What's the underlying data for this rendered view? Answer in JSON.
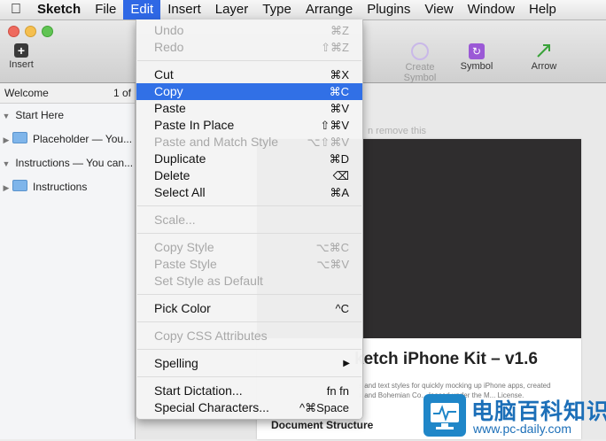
{
  "menubar": {
    "app": "Sketch",
    "items": [
      "File",
      "Edit",
      "Insert",
      "Layer",
      "Type",
      "Arrange",
      "Plugins",
      "View",
      "Window",
      "Help"
    ],
    "active": "Edit"
  },
  "toolbar": {
    "insert_label": "Insert",
    "create_symbol_label": "Create Symbol",
    "symbol_label": "Symbol",
    "arrow_label": "Arrow"
  },
  "sidebar": {
    "page_label": "Welcome",
    "page_count": "1 of",
    "rows": [
      {
        "label": "Start Here",
        "kind": "group"
      },
      {
        "label": "Placeholder — You...",
        "kind": "folder"
      },
      {
        "label": "Instructions — You can...",
        "kind": "group"
      },
      {
        "label": "Instructions",
        "kind": "folder"
      }
    ]
  },
  "canvas": {
    "hint": "n remove this",
    "artboard_title": "ketch iPhone Kit – v1.6",
    "artboard_desc_1": "s and text styles for quickly mocking up iPhone apps, created",
    "artboard_desc_2": "x and Bohemian Co... leased under the M... License.",
    "doc_structure": "Document Structure"
  },
  "edit_menu": {
    "undo": {
      "label": "Undo",
      "shortcut": "⌘Z"
    },
    "redo": {
      "label": "Redo",
      "shortcut": "⇧⌘Z"
    },
    "cut": {
      "label": "Cut",
      "shortcut": "⌘X"
    },
    "copy": {
      "label": "Copy",
      "shortcut": "⌘C"
    },
    "paste": {
      "label": "Paste",
      "shortcut": "⌘V"
    },
    "paste_in_place": {
      "label": "Paste In Place",
      "shortcut": "⇧⌘V"
    },
    "paste_match": {
      "label": "Paste and Match Style",
      "shortcut": "⌥⇧⌘V"
    },
    "duplicate": {
      "label": "Duplicate",
      "shortcut": "⌘D"
    },
    "delete": {
      "label": "Delete",
      "shortcut": "⌫"
    },
    "select_all": {
      "label": "Select All",
      "shortcut": "⌘A"
    },
    "scale": {
      "label": "Scale..."
    },
    "copy_style": {
      "label": "Copy Style",
      "shortcut": "⌥⌘C"
    },
    "paste_style": {
      "label": "Paste Style",
      "shortcut": "⌥⌘V"
    },
    "set_style_default": {
      "label": "Set Style as Default"
    },
    "pick_color": {
      "label": "Pick Color",
      "shortcut": "^C"
    },
    "copy_css": {
      "label": "Copy CSS Attributes"
    },
    "spelling": {
      "label": "Spelling"
    },
    "start_dictation": {
      "label": "Start Dictation...",
      "shortcut": "fn fn"
    },
    "special_chars": {
      "label": "Special Characters...",
      "shortcut": "^⌘Space"
    }
  },
  "watermark": {
    "cn": "电脑百科知识",
    "url": "www.pc-daily.com"
  },
  "colors": {
    "highlight": "#3170e6",
    "menubar_active": "#2f68e5",
    "symbol_purple": "#9b59d6",
    "arrow_green": "#3aa23a"
  }
}
